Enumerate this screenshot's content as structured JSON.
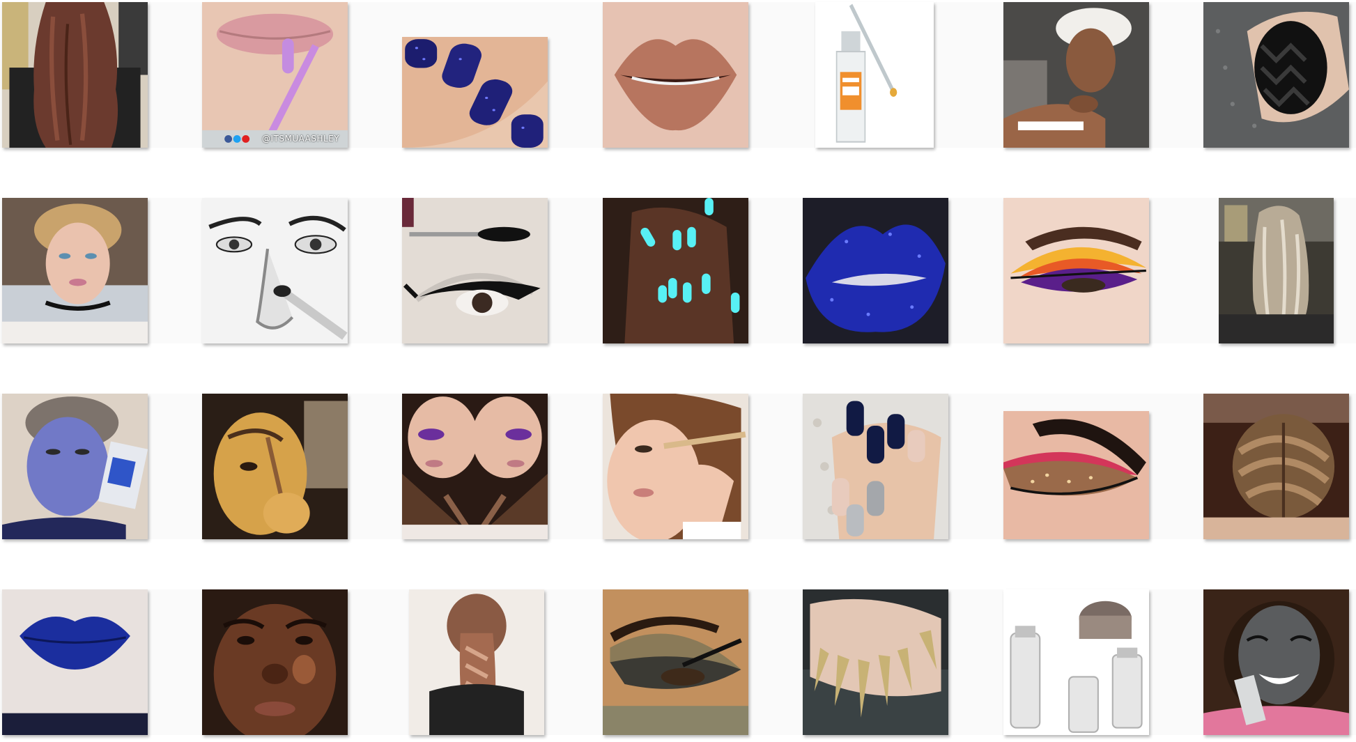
{
  "gallery": {
    "items": [
      {
        "name": "long-wavy-brown-hair"
      },
      {
        "name": "pink-lip-applicator",
        "caption": "@ITSMUAASHLEY"
      },
      {
        "name": "blue-glitter-nails"
      },
      {
        "name": "nude-matte-lips"
      },
      {
        "name": "serum-dropper-bottle"
      },
      {
        "name": "woman-in-hair-towel"
      },
      {
        "name": "black-chevron-nail-art"
      },
      {
        "name": "blonde-woman-choker"
      },
      {
        "name": "nose-contour-sketch"
      },
      {
        "name": "winged-eyeliner-mascara"
      },
      {
        "name": "glow-in-dark-nails"
      },
      {
        "name": "blue-glitter-lips"
      },
      {
        "name": "sunset-eyeshadow-look"
      },
      {
        "name": "blonde-balayage-hair"
      },
      {
        "name": "blue-metallic-face-mask"
      },
      {
        "name": "eyebrow-brush-tutorial"
      },
      {
        "name": "purple-smokey-eye-mirror"
      },
      {
        "name": "eyeliner-pencil-application"
      },
      {
        "name": "black-glitter-coffin-nails"
      },
      {
        "name": "pink-glitter-cut-crease"
      },
      {
        "name": "fishtail-braid-updo"
      },
      {
        "name": "deep-blue-lips"
      },
      {
        "name": "glowing-skin-portrait"
      },
      {
        "name": "long-braid-back-view"
      },
      {
        "name": "gold-smokey-eye"
      },
      {
        "name": "gold-stiletto-nails"
      },
      {
        "name": "skincare-jars-set"
      },
      {
        "name": "charcoal-mask-smile"
      }
    ]
  }
}
